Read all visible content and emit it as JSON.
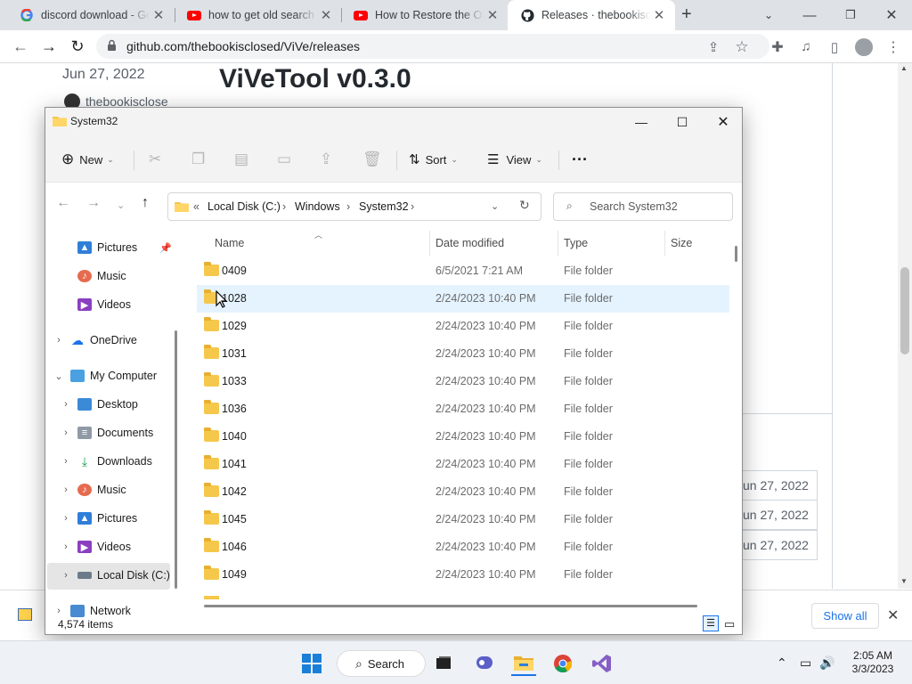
{
  "browser": {
    "tabs": [
      {
        "title": "discord download - Go",
        "icon": "google-icon"
      },
      {
        "title": "how to get old search f",
        "icon": "youtube-icon"
      },
      {
        "title": "How to Restore the Ol",
        "icon": "youtube-icon"
      },
      {
        "title": "Releases · thebookisclo",
        "icon": "github-icon",
        "active": true
      }
    ],
    "url": "github.com/thebookisclosed/ViVe/releases"
  },
  "github": {
    "date": "Jun 27, 2022",
    "user": "thebookisclose",
    "release_title": "ViVeTool v0.3.0",
    "asset_dates": [
      "un 27, 2022",
      "un 27, 2022",
      "un 27, 2022"
    ]
  },
  "downloads": {
    "show_all": "Show all"
  },
  "explorer": {
    "window_title": "System32",
    "commands": {
      "new": "New",
      "sort": "Sort",
      "view": "View"
    },
    "breadcrumb": [
      "Local Disk (C:)",
      "Windows",
      "System32"
    ],
    "search_placeholder": "Search System32",
    "nav": {
      "pictures_pinned": "Pictures",
      "music": "Music",
      "videos": "Videos",
      "onedrive": "OneDrive",
      "my_computer": "My Computer",
      "desktop": "Desktop",
      "documents": "Documents",
      "downloads": "Downloads",
      "music2": "Music",
      "pictures2": "Pictures",
      "videos2": "Videos",
      "local_disk": "Local Disk (C:)",
      "network": "Network"
    },
    "columns": {
      "name": "Name",
      "date": "Date modified",
      "type": "Type",
      "size": "Size"
    },
    "files": [
      {
        "name": "0409",
        "date": "6/5/2021 7:21 AM",
        "type": "File folder"
      },
      {
        "name": "1028",
        "date": "2/24/2023 10:40 PM",
        "type": "File folder"
      },
      {
        "name": "1029",
        "date": "2/24/2023 10:40 PM",
        "type": "File folder"
      },
      {
        "name": "1031",
        "date": "2/24/2023 10:40 PM",
        "type": "File folder"
      },
      {
        "name": "1033",
        "date": "2/24/2023 10:40 PM",
        "type": "File folder"
      },
      {
        "name": "1036",
        "date": "2/24/2023 10:40 PM",
        "type": "File folder"
      },
      {
        "name": "1040",
        "date": "2/24/2023 10:40 PM",
        "type": "File folder"
      },
      {
        "name": "1041",
        "date": "2/24/2023 10:40 PM",
        "type": "File folder"
      },
      {
        "name": "1042",
        "date": "2/24/2023 10:40 PM",
        "type": "File folder"
      },
      {
        "name": "1045",
        "date": "2/24/2023 10:40 PM",
        "type": "File folder"
      },
      {
        "name": "1046",
        "date": "2/24/2023 10:40 PM",
        "type": "File folder"
      },
      {
        "name": "1049",
        "date": "2/24/2023 10:40 PM",
        "type": "File folder"
      }
    ],
    "status": "4,574 items"
  },
  "taskbar": {
    "search": "Search",
    "time": "2:05 AM",
    "date": "3/3/2023"
  }
}
